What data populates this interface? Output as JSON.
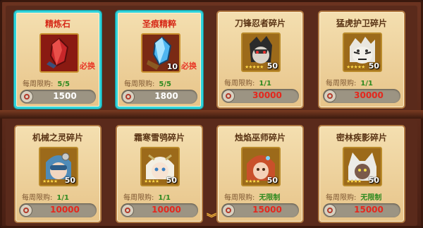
{
  "shop": {
    "items": [
      {
        "name": "精炼石",
        "limit_label": "每周限购:",
        "limit_value": "5/5",
        "price": "1500",
        "selected": true,
        "affordable": true,
        "badge": "必换",
        "qty": "",
        "stars": "",
        "icon": "red-crystal-icon"
      },
      {
        "name": "圣痕精粹",
        "limit_label": "每周限购:",
        "limit_value": "5/5",
        "price": "1800",
        "selected": true,
        "affordable": true,
        "badge": "必换",
        "qty": "10",
        "stars": "",
        "icon": "blue-crystal-icon"
      },
      {
        "name": "刀锋忍者碎片",
        "limit_label": "每周限购:",
        "limit_value": "1/1",
        "price": "30000",
        "selected": false,
        "affordable": false,
        "badge": "",
        "qty": "50",
        "stars": "★★★★★",
        "icon": "blade-ninja-portrait"
      },
      {
        "name": "猛虎护卫碎片",
        "limit_label": "每周限购:",
        "limit_value": "1/1",
        "price": "30000",
        "selected": false,
        "affordable": false,
        "badge": "",
        "qty": "50",
        "stars": "★★★★★",
        "icon": "tiger-guard-portrait"
      },
      {
        "name": "机械之灵碎片",
        "limit_label": "每周限购:",
        "limit_value": "1/1",
        "price": "10000",
        "selected": false,
        "affordable": false,
        "badge": "",
        "qty": "50",
        "stars": "★★★★",
        "icon": "mech-spirit-portrait"
      },
      {
        "name": "霜寒雪鸮碎片",
        "limit_label": "每周限购:",
        "limit_value": "1/1",
        "price": "10000",
        "selected": false,
        "affordable": false,
        "badge": "",
        "qty": "50",
        "stars": "★★★★",
        "icon": "frost-owl-portrait"
      },
      {
        "name": "烛焰巫师碎片",
        "limit_label": "每周限购:",
        "limit_value": "无限制",
        "price": "15000",
        "selected": false,
        "affordable": false,
        "badge": "",
        "qty": "50",
        "stars": "★★★★",
        "icon": "flame-wizard-portrait"
      },
      {
        "name": "密林疾影碎片",
        "limit_label": "每周限购:",
        "limit_value": "无限制",
        "price": "15000",
        "selected": false,
        "affordable": false,
        "badge": "",
        "qty": "50",
        "stars": "★★★★",
        "icon": "forest-shadow-portrait"
      }
    ]
  },
  "colors": {
    "selected_border": "#2fd3db",
    "price_unaffordable": "#e5271d",
    "limit_value": "#2f8a20"
  }
}
